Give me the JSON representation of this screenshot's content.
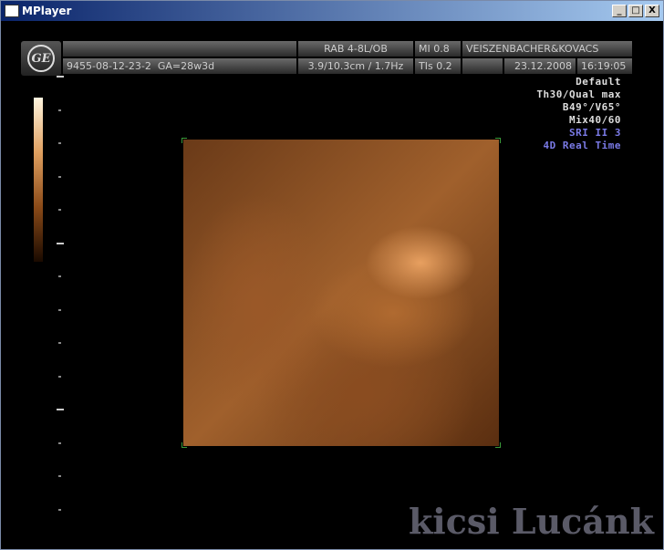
{
  "window": {
    "title": "MPlayer",
    "controls": [
      "_",
      "□",
      "X"
    ]
  },
  "header": {
    "logo": "GE",
    "patient_id": "9455-08-12-23-2",
    "ga": "GA=28w3d",
    "probe": "RAB 4-8L/OB",
    "depth": "3.9/10.3cm / 1.7Hz",
    "mi": "MI  0.8",
    "tis": "TIs  0.2",
    "institution": "VEISZENBACHER&KOVACS",
    "date": "23.12.2008",
    "time": "16:19:05"
  },
  "info": {
    "lines": [
      "Default",
      "Th30/Qual max",
      "B49°/V65°",
      "Mix40/60"
    ],
    "blue_lines": [
      "SRI II 3",
      "4D Real Time"
    ]
  },
  "watermark": "kicsi Lucánk"
}
